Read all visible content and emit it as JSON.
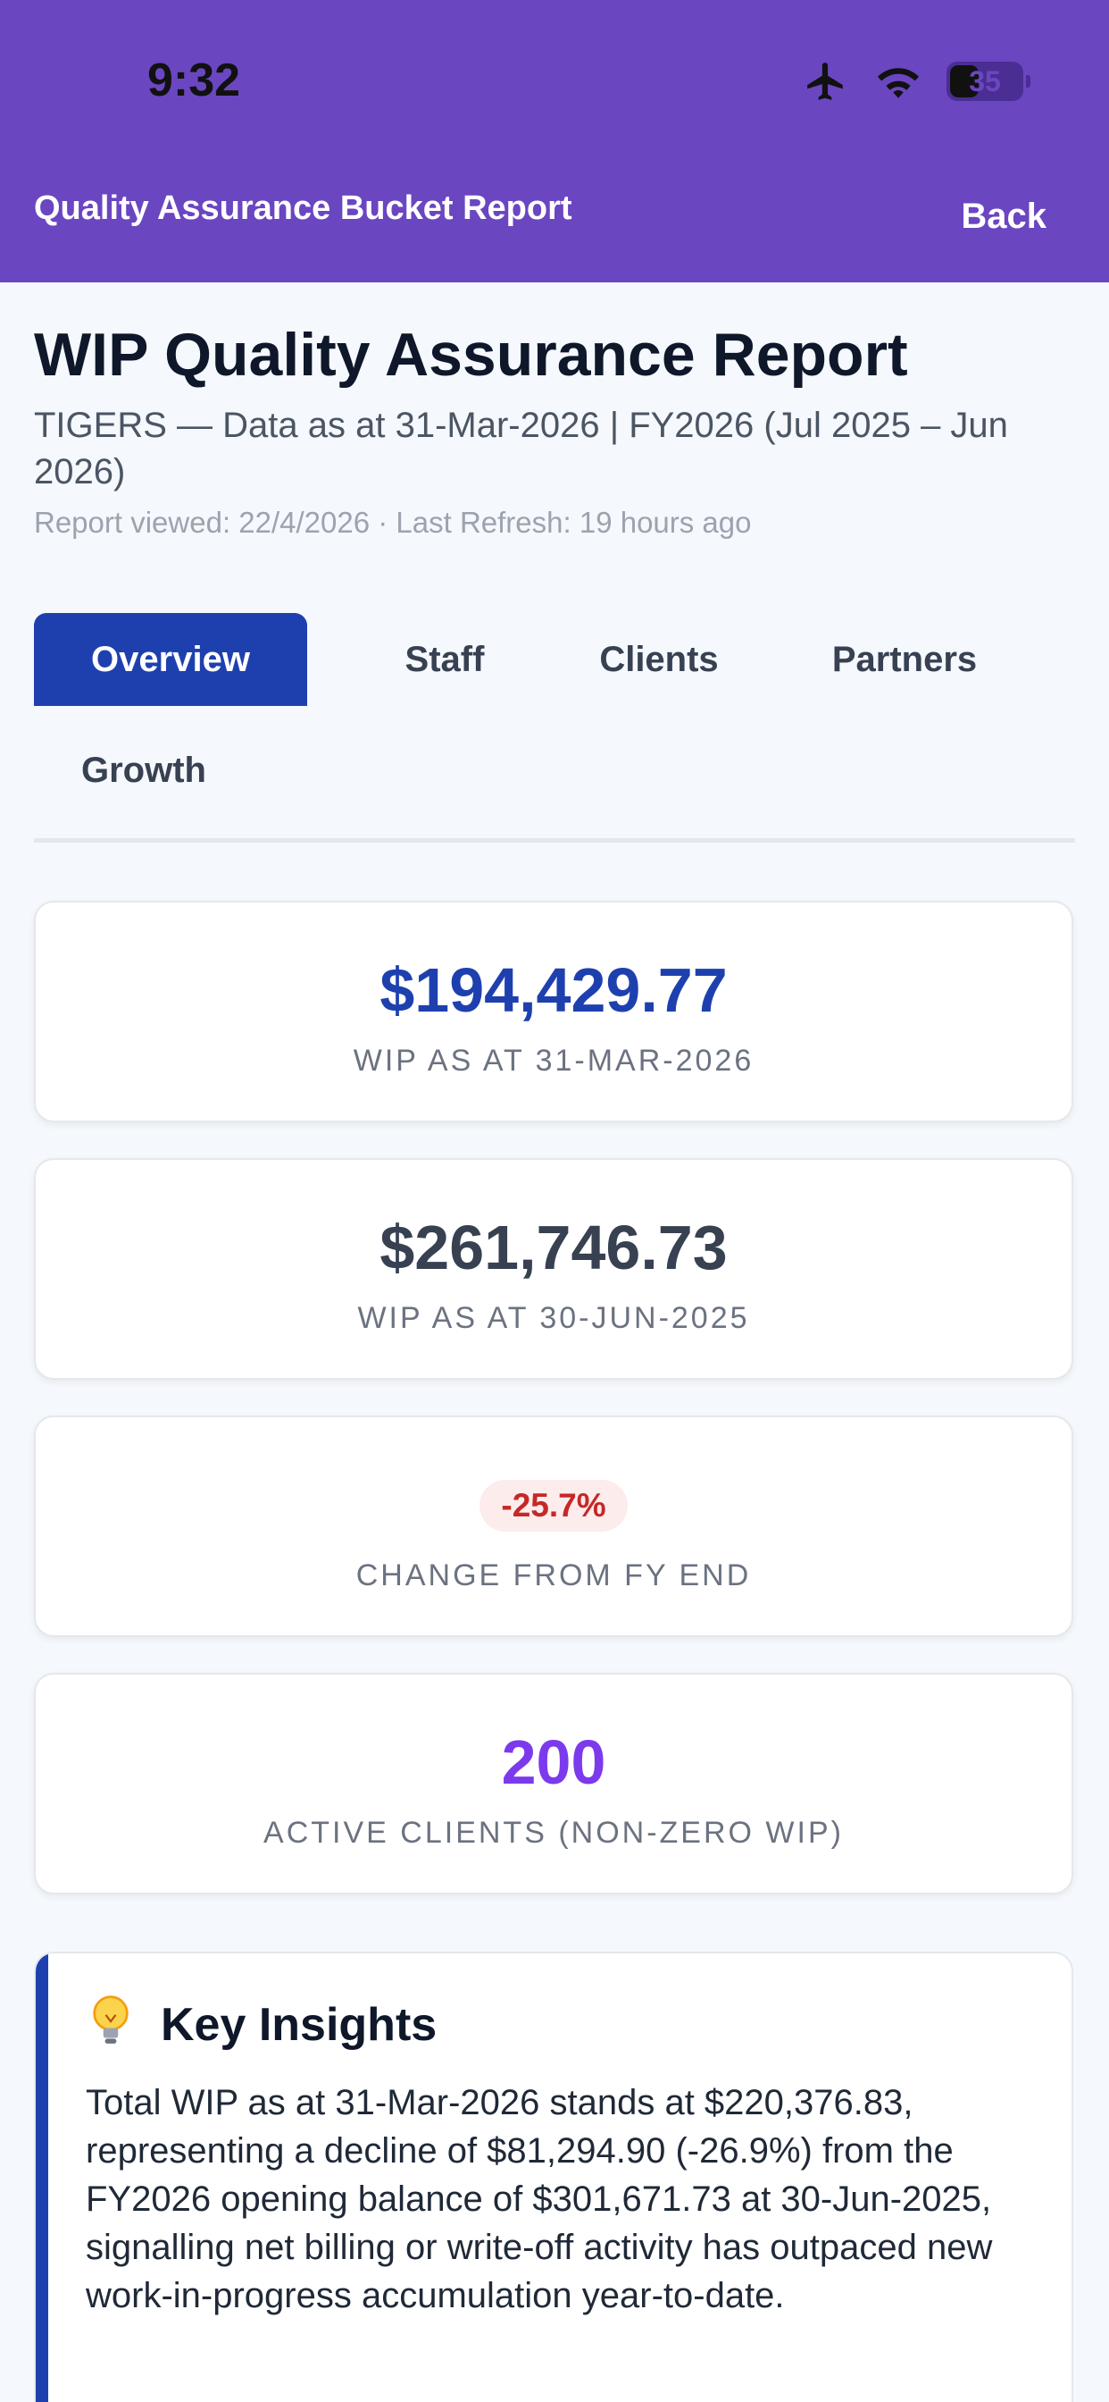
{
  "status_bar": {
    "time": "9:32",
    "battery": "35"
  },
  "nav": {
    "title": "Quality Assurance Bucket Report",
    "back": "Back"
  },
  "report": {
    "title": "WIP Quality Assurance Report",
    "subtitle": "TIGERS — Data as at 31-Mar-2026 | FY2026 (Jul 2025 – Jun 2026)",
    "meta": "Report viewed: 22/4/2026 · Last Refresh: 19 hours ago"
  },
  "tabs": [
    {
      "label": "Overview",
      "active": true
    },
    {
      "label": "Staff"
    },
    {
      "label": "Clients"
    },
    {
      "label": "Partners"
    },
    {
      "label": "Growth"
    }
  ],
  "cards": {
    "wip_current": {
      "value": "$194,429.77",
      "label": "WIP AS AT 31-MAR-2026"
    },
    "wip_fy_end": {
      "value": "$261,746.73",
      "label": "WIP AS AT 30-JUN-2025"
    },
    "change": {
      "value": "-25.7%",
      "label": "CHANGE FROM FY END"
    },
    "active_clients": {
      "value": "200",
      "label": "ACTIVE CLIENTS (NON-ZERO WIP)"
    }
  },
  "insights": {
    "title": "Key Insights",
    "body": "Total WIP as at 31-Mar-2026 stands at $220,376.83, representing a decline of $81,294.90 (-26.9%) from the FY2026 opening balance of $301,671.73 at 30-Jun-2025, signalling net billing or write-off activity has outpaced new work-in-progress accumulation year-to-date."
  },
  "colors": {
    "header": "#6b46c1",
    "accent": "#1e40af",
    "negative": "#c62828",
    "clients": "#7c3aed"
  }
}
